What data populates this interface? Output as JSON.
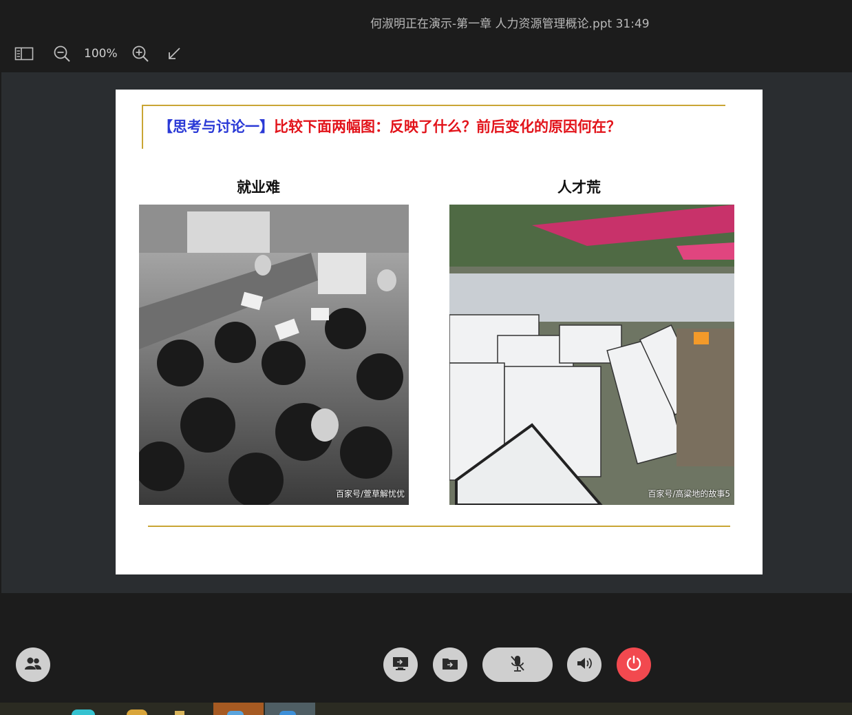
{
  "window": {
    "title": "何淑明正在演示-第一章 人力资源管理概论.ppt 31:49"
  },
  "toolbar": {
    "zoom_level": "100%"
  },
  "slide": {
    "heading_prefix": "【思考与讨论一】",
    "heading_question": "比较下面两幅图：反映了什么？前后变化的原因何在？",
    "left_caption": "就业难",
    "right_caption": "人才荒",
    "left_watermark": "百家号/萱草解忧优",
    "right_watermark": "百家号/高粱地的故事5"
  },
  "colors": {
    "accent_gold": "#c9a534",
    "heading_blue": "#2a39d6",
    "heading_red": "#e2131a",
    "end_call_red": "#f2494f"
  }
}
